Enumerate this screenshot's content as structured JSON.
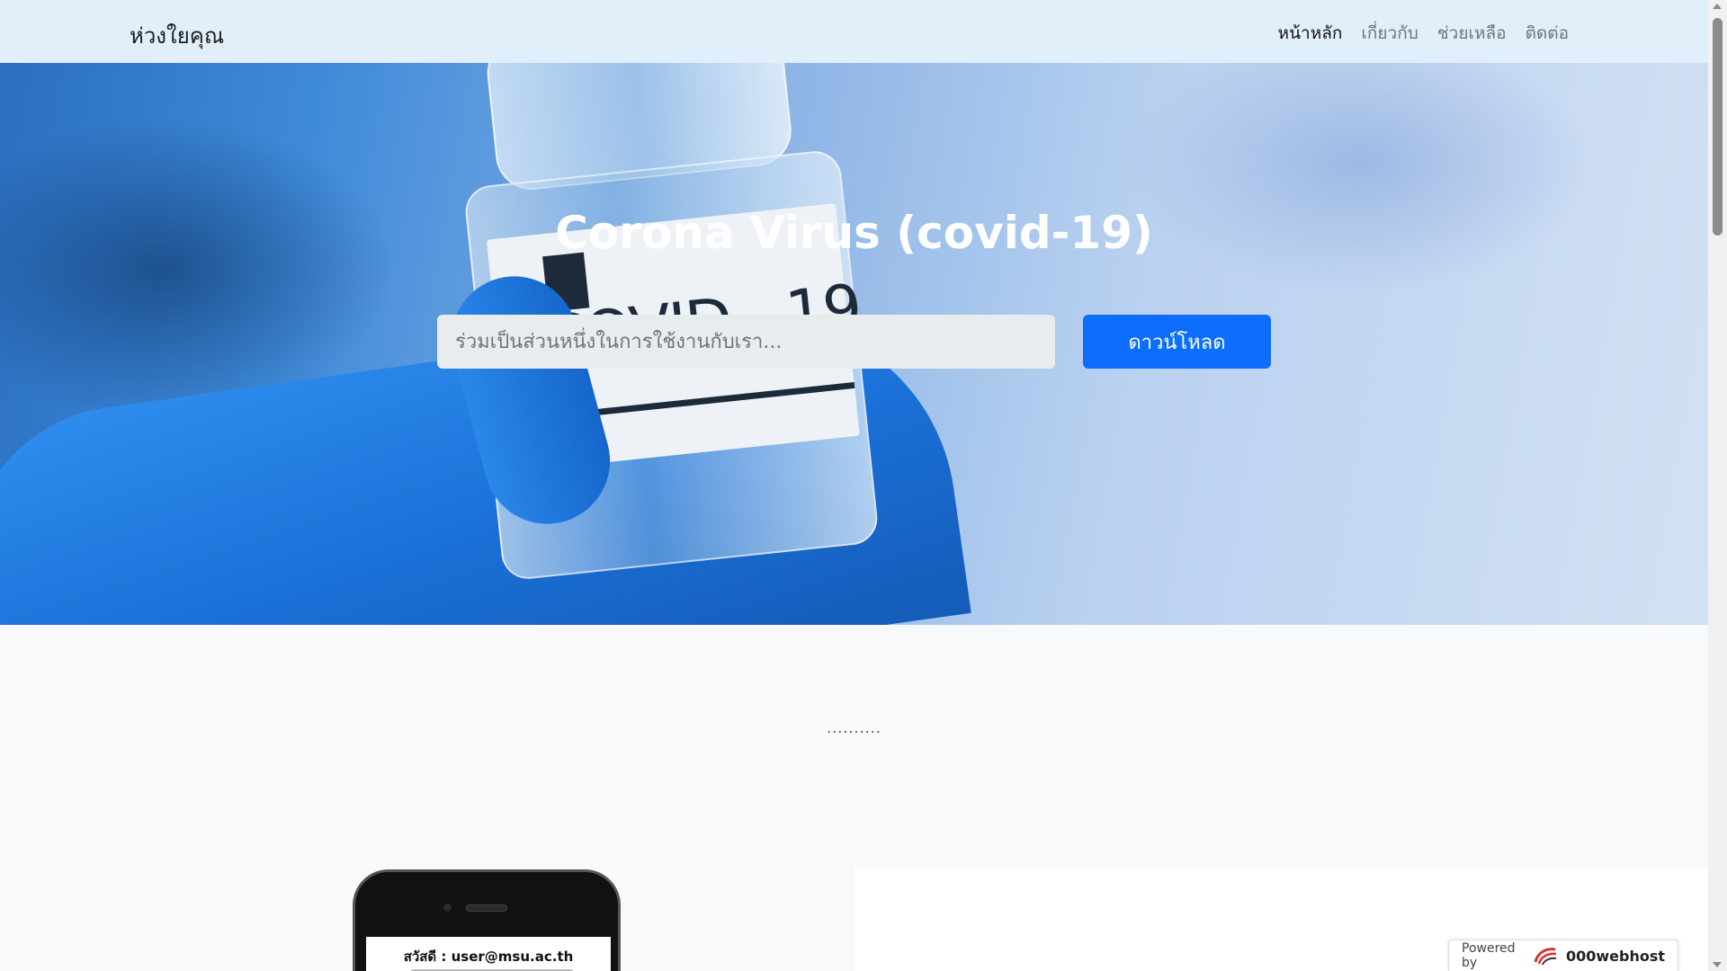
{
  "navbar": {
    "brand": "ห่วงใยคุณ",
    "links": [
      {
        "label": "หน้าหลัก",
        "active": true
      },
      {
        "label": "เกี่ยวกับ",
        "active": false
      },
      {
        "label": "ช่วยเหลือ",
        "active": false
      },
      {
        "label": "ติดต่อ",
        "active": false
      }
    ]
  },
  "hero": {
    "title": "Corona Virus (covid-19)",
    "vial_label": "COVID - 19",
    "search_placeholder": "ร่วมเป็นส่วนหนึ่งในการใช้งานกับเรา...",
    "download_label": "ดาวน์โหลด"
  },
  "middle": {
    "dots": ".........."
  },
  "phone": {
    "greeting": "สวัสดี : user@msu.ac.th"
  },
  "powered": {
    "text": "Powered by",
    "brand": "000webhost"
  },
  "colors": {
    "navbar_bg": "#e1effb",
    "primary_button": "#0d6efd",
    "input_bg": "#e9ecef"
  }
}
